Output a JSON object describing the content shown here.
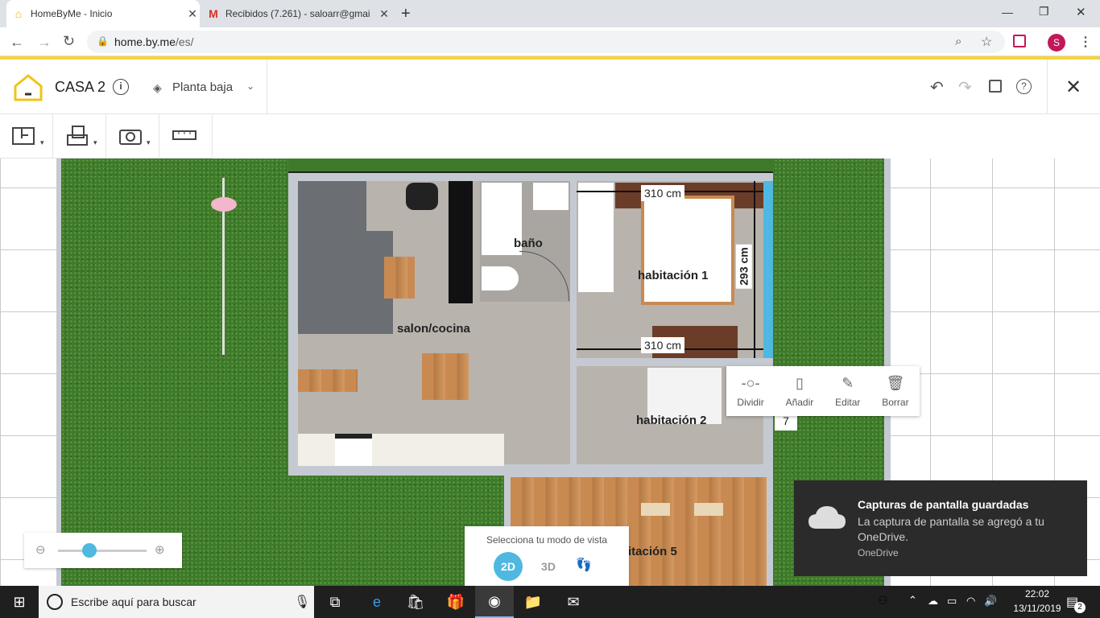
{
  "browser": {
    "tabs": [
      {
        "title": "HomeByMe - Inicio",
        "active": true
      },
      {
        "title": "Recibidos (7.261) - saloarr@gmai",
        "active": false
      }
    ],
    "new_tab": "+",
    "url_host": "home.by.me",
    "url_path": "/es/",
    "profile_initial": "S",
    "window_controls": {
      "minimize": "—",
      "maximize": "❐",
      "close": "✕"
    }
  },
  "app": {
    "project_title": "CASA 2",
    "floor_selector": "Planta baja",
    "close_label": "✕"
  },
  "plan": {
    "rooms": {
      "living": "salon/cocina",
      "bath": "baño",
      "bed1": "habitación 1",
      "bed2": "habitación 2",
      "room5": "itación 5"
    },
    "dimensions": {
      "top": "310 cm",
      "bottom": "310 cm",
      "side": "293 cm",
      "partial": "7"
    }
  },
  "context_menu": {
    "items": [
      {
        "label": "Dividir",
        "icon": "split-icon"
      },
      {
        "label": "Añadir",
        "icon": "add-door-icon"
      },
      {
        "label": "Editar",
        "icon": "pencil-icon"
      },
      {
        "label": "Borrar",
        "icon": "trash-icon"
      }
    ]
  },
  "zoom": {
    "level": 0.35
  },
  "view_mode": {
    "title": "Selecciona tu modo de vista",
    "options": [
      "2D",
      "3D"
    ],
    "selected": "2D"
  },
  "toast": {
    "title": "Capturas de pantalla guardadas",
    "body": "La captura de pantalla se agregó a tu OneDrive.",
    "source": "OneDrive"
  },
  "taskbar": {
    "search_placeholder": "Escribe aquí para buscar",
    "time": "22:02",
    "date": "13/11/2019",
    "notifications": "2"
  },
  "colors": {
    "brand_yellow": "#f6d33d",
    "accent_blue": "#4fb8e0",
    "grass": "#3f7a2c"
  }
}
